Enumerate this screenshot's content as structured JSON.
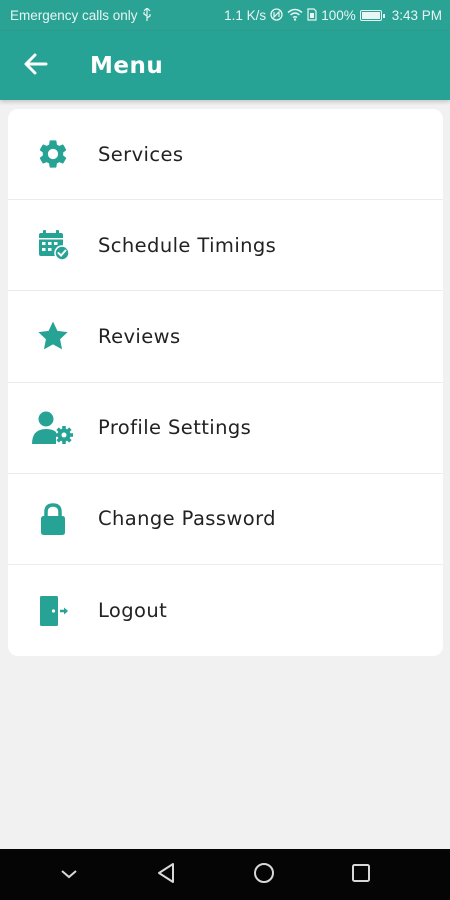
{
  "status_bar": {
    "carrier": "Emergency calls only",
    "speed": "1.1 K/s",
    "battery": "100%",
    "time": "3:43 PM"
  },
  "app_bar": {
    "title": "Menu",
    "back_icon": "arrow-left-icon"
  },
  "menu": {
    "items": [
      {
        "label": "Services",
        "icon": "gear-icon"
      },
      {
        "label": "Schedule Timings",
        "icon": "calendar-check-icon"
      },
      {
        "label": "Reviews",
        "icon": "star-icon"
      },
      {
        "label": "Profile Settings",
        "icon": "user-gear-icon"
      },
      {
        "label": "Change Password",
        "icon": "lock-icon"
      },
      {
        "label": "Logout",
        "icon": "logout-door-icon"
      }
    ]
  },
  "nav_bar": {
    "buttons": [
      "chevron-down-icon",
      "back-triangle-icon",
      "home-circle-icon",
      "recents-square-icon"
    ]
  },
  "colors": {
    "primary": "#26a394",
    "status_bar": "#2aa294",
    "background": "#f1f1f1",
    "text": "#222222"
  }
}
